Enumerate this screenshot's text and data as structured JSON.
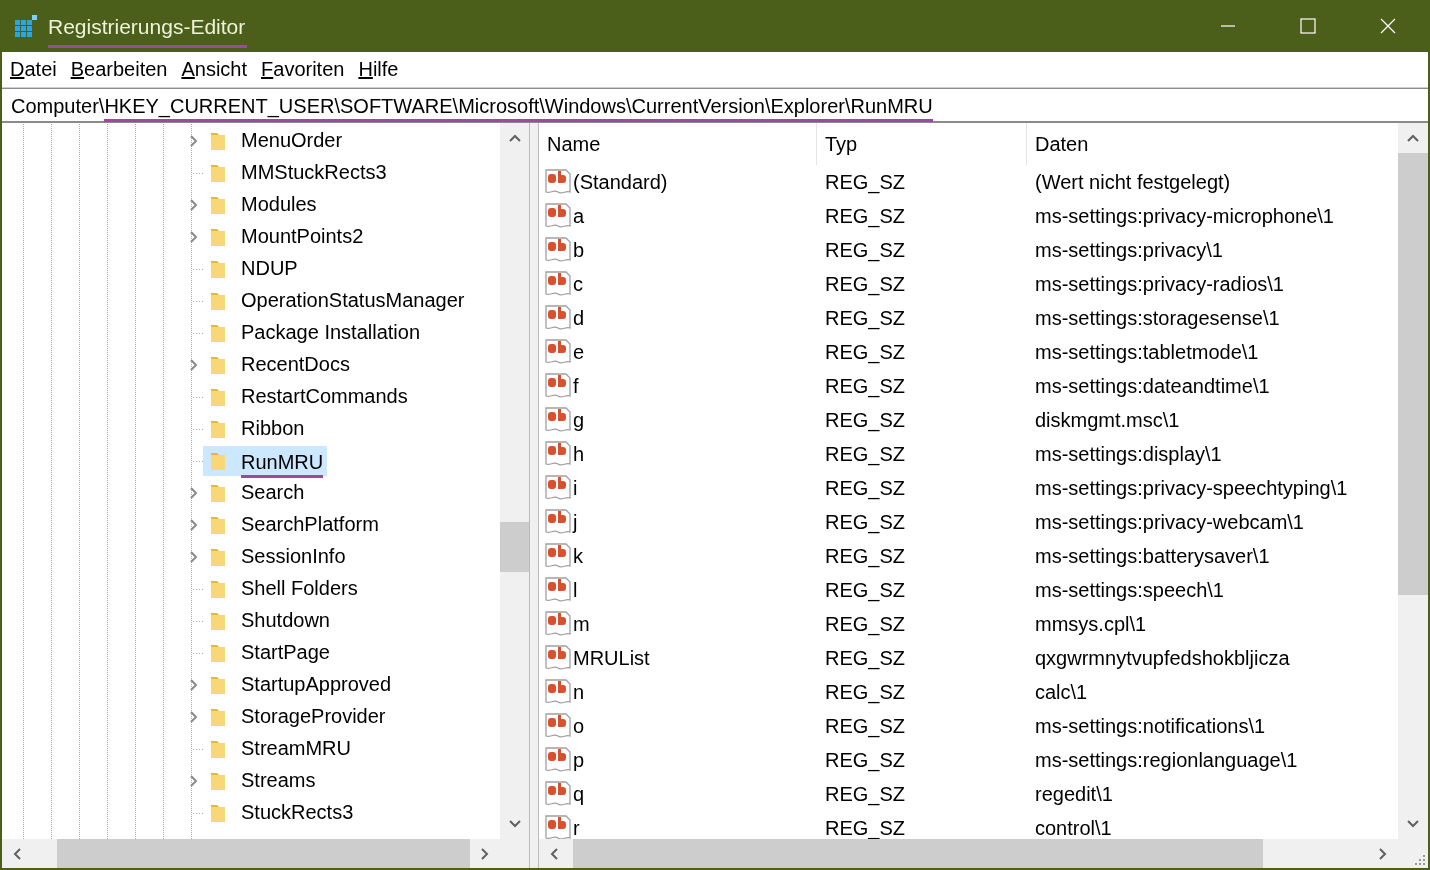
{
  "window": {
    "title": "Registrierungs-Editor",
    "title_underlined": true
  },
  "menu": [
    {
      "label": "Datei"
    },
    {
      "label": "Bearbeiten"
    },
    {
      "label": "Ansicht"
    },
    {
      "label": "Favoriten"
    },
    {
      "label": "Hilfe"
    }
  ],
  "address": {
    "segments": [
      {
        "text": "Computer\\",
        "underlined": false
      },
      {
        "text": "HKEY_CURRENT_USER\\SOFTWARE\\Microsoft\\Windows\\CurrentVersion\\Explorer\\RunMRU",
        "underlined": true
      }
    ]
  },
  "tree": {
    "items": [
      {
        "label": "MenuOrder",
        "has_children": true,
        "selected": false,
        "underlined": false
      },
      {
        "label": "MMStuckRects3",
        "has_children": false,
        "selected": false,
        "underlined": false
      },
      {
        "label": "Modules",
        "has_children": true,
        "selected": false,
        "underlined": false
      },
      {
        "label": "MountPoints2",
        "has_children": true,
        "selected": false,
        "underlined": false
      },
      {
        "label": "NDUP",
        "has_children": false,
        "selected": false,
        "underlined": false
      },
      {
        "label": "OperationStatusManager",
        "has_children": false,
        "selected": false,
        "underlined": false
      },
      {
        "label": "Package Installation",
        "has_children": false,
        "selected": false,
        "underlined": false
      },
      {
        "label": "RecentDocs",
        "has_children": true,
        "selected": false,
        "underlined": false
      },
      {
        "label": "RestartCommands",
        "has_children": false,
        "selected": false,
        "underlined": false
      },
      {
        "label": "Ribbon",
        "has_children": false,
        "selected": false,
        "underlined": false
      },
      {
        "label": "RunMRU",
        "has_children": false,
        "selected": true,
        "underlined": true
      },
      {
        "label": "Search",
        "has_children": true,
        "selected": false,
        "underlined": false
      },
      {
        "label": "SearchPlatform",
        "has_children": true,
        "selected": false,
        "underlined": false
      },
      {
        "label": "SessionInfo",
        "has_children": true,
        "selected": false,
        "underlined": false
      },
      {
        "label": "Shell Folders",
        "has_children": false,
        "selected": false,
        "underlined": false
      },
      {
        "label": "Shutdown",
        "has_children": false,
        "selected": false,
        "underlined": false
      },
      {
        "label": "StartPage",
        "has_children": false,
        "selected": false,
        "underlined": false
      },
      {
        "label": "StartupApproved",
        "has_children": true,
        "selected": false,
        "underlined": false
      },
      {
        "label": "StorageProvider",
        "has_children": true,
        "selected": false,
        "underlined": false
      },
      {
        "label": "StreamMRU",
        "has_children": false,
        "selected": false,
        "underlined": false
      },
      {
        "label": "Streams",
        "has_children": true,
        "selected": false,
        "underlined": false
      },
      {
        "label": "StuckRects3",
        "has_children": false,
        "selected": false,
        "underlined": false
      }
    ]
  },
  "table": {
    "columns": [
      "Name",
      "Typ",
      "Daten"
    ],
    "rows": [
      {
        "name": "(Standard)",
        "type": "REG_SZ",
        "data": "(Wert nicht festgelegt)"
      },
      {
        "name": "a",
        "type": "REG_SZ",
        "data": "ms-settings:privacy-microphone\\1"
      },
      {
        "name": "b",
        "type": "REG_SZ",
        "data": "ms-settings:privacy\\1"
      },
      {
        "name": "c",
        "type": "REG_SZ",
        "data": "ms-settings:privacy-radios\\1"
      },
      {
        "name": "d",
        "type": "REG_SZ",
        "data": "ms-settings:storagesense\\1"
      },
      {
        "name": "e",
        "type": "REG_SZ",
        "data": "ms-settings:tabletmode\\1"
      },
      {
        "name": "f",
        "type": "REG_SZ",
        "data": "ms-settings:dateandtime\\1"
      },
      {
        "name": "g",
        "type": "REG_SZ",
        "data": "diskmgmt.msc\\1"
      },
      {
        "name": "h",
        "type": "REG_SZ",
        "data": "ms-settings:display\\1"
      },
      {
        "name": "i",
        "type": "REG_SZ",
        "data": "ms-settings:privacy-speechtyping\\1"
      },
      {
        "name": "j",
        "type": "REG_SZ",
        "data": "ms-settings:privacy-webcam\\1"
      },
      {
        "name": "k",
        "type": "REG_SZ",
        "data": "ms-settings:batterysaver\\1"
      },
      {
        "name": "l",
        "type": "REG_SZ",
        "data": "ms-settings:speech\\1"
      },
      {
        "name": "m",
        "type": "REG_SZ",
        "data": "mmsys.cpl\\1"
      },
      {
        "name": "MRUList",
        "type": "REG_SZ",
        "data": "qxgwrmnytvupfedshokbljicza"
      },
      {
        "name": "n",
        "type": "REG_SZ",
        "data": "calc\\1"
      },
      {
        "name": "o",
        "type": "REG_SZ",
        "data": "ms-settings:notifications\\1"
      },
      {
        "name": "p",
        "type": "REG_SZ",
        "data": "ms-settings:regionlanguage\\1"
      },
      {
        "name": "q",
        "type": "REG_SZ",
        "data": "regedit\\1"
      },
      {
        "name": "r",
        "type": "REG_SZ",
        "data": "control\\1"
      }
    ]
  }
}
